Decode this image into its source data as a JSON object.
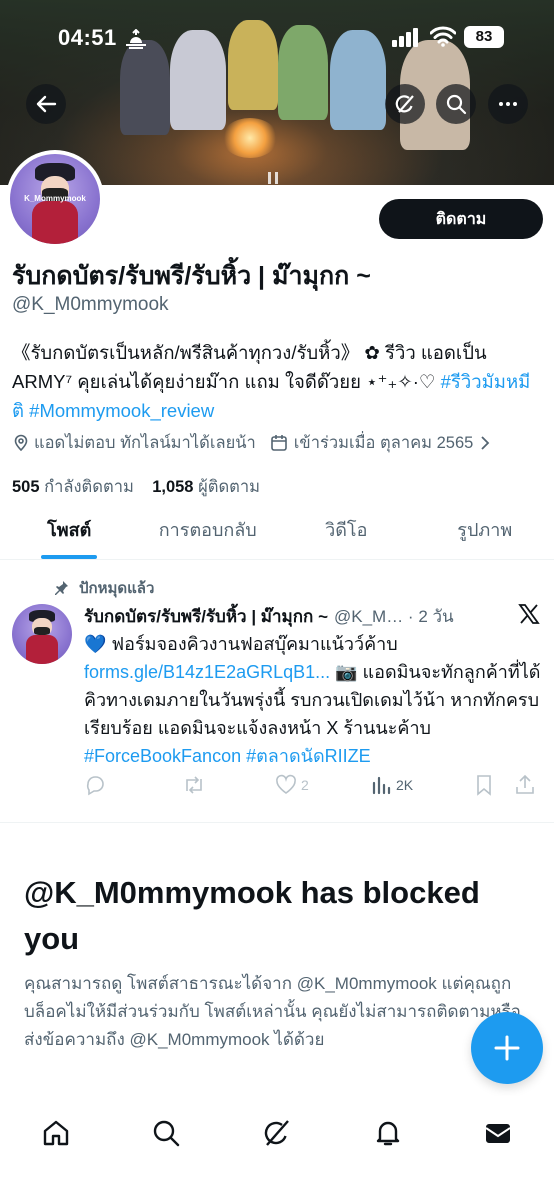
{
  "status_bar": {
    "time": "04:51",
    "battery": "83"
  },
  "profile": {
    "display_name": "รับกดบัตร/รับพรี/รับหิ้ว | ม๊ามุกก ~",
    "handle": "@K_M0mmymook",
    "follow_label": "ติดตาม",
    "avatar_text": "K_Mommymook",
    "bio_text": "《รับกดบัตรเป็นหลัก/พรีสินค้าทุกวง/รับหิ้ว》 ✿ รีวิว แอดเป็น ARMY⁷ คุยเล่นได้คุยง่ายม๊าก แถม ใจดีด๊วยย ⋆⁺₊✧·♡ ",
    "bio_link_1": "#รีวิวมัมหมีติ",
    "bio_link_2": "#Mommymook_review",
    "location": "แอดไม่ตอบ ทักไลน์มาได้เลยน้า",
    "joined": "เข้าร่วมเมื่อ ตุลาคม 2565",
    "following_count": "505",
    "following_label": "กำลังติดตาม",
    "followers_count": "1,058",
    "followers_label": "ผู้ติดตาม"
  },
  "tabs": [
    {
      "label": "โพสต์"
    },
    {
      "label": "การตอบกลับ"
    },
    {
      "label": "วิดีโอ"
    },
    {
      "label": "รูปภาพ"
    }
  ],
  "pinned_post": {
    "pinned_label": "ปักหมุดแล้ว",
    "name": "รับกดบัตร/รับพรี/รับหิ้ว | ม๊ามุกก ~",
    "handle_time": "@K_M… · 2 วัน",
    "text_1": "💙 ฟอร์มจองคิวงานฟอสบุ๊คมาแน้วว์ค้าบ ",
    "link_1": "forms.gle/B14z1E2aGRLqB1...",
    "text_2": " 📷 แอดมินจะทักลูกค้าที่ได้คิวทางเดมภายในวันพรุ่งนี้ รบกวนเปิดเดมไว้น้า หากทักครบเรียบร้อย แอดมินจะแจ้งลงหน้า X ร้านนะค้าบ ",
    "link_2": "#ForceBookFancon",
    "link_3": "#ตลาดนัดRIIZE",
    "likes": "2",
    "views": "2K"
  },
  "blocked": {
    "title": "@K_M0mmymook has blocked you",
    "body": "คุณสามารถดู โพสต์สาธารณะได้จาก @K_M0mmymook แต่คุณถูกบล็อคไม่ให้มีส่วนร่วมกับ โพสต์เหล่านั้น คุณยังไม่สามารถติดตามหรือส่งข้อความถึง @K_M0mmymook ได้ด้วย"
  },
  "icons": {
    "back": "arrow-left-icon",
    "grok": "grok-icon",
    "search": "search-icon",
    "more": "more-icon",
    "fab": "plus-icon",
    "nav": [
      "home-icon",
      "search-icon",
      "grok-icon",
      "bell-icon",
      "mail-icon"
    ]
  },
  "colors": {
    "accent": "#1d9bf0",
    "text": "#0f1419",
    "muted": "#536471"
  }
}
